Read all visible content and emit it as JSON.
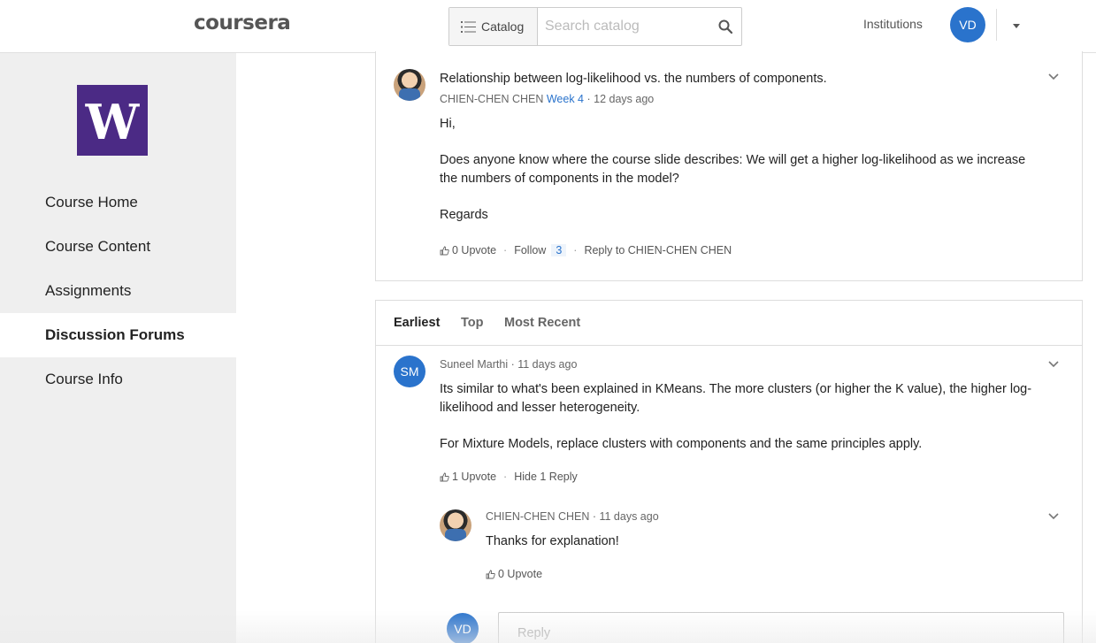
{
  "header": {
    "logo_text": "coursera",
    "catalog_label": "Catalog",
    "search_placeholder": "Search catalog",
    "institutions_label": "Institutions",
    "user_initials": "VD"
  },
  "sidebar": {
    "logo_letter": "W",
    "items": [
      {
        "label": "Course Home"
      },
      {
        "label": "Course Content"
      },
      {
        "label": "Assignments"
      },
      {
        "label": "Discussion Forums",
        "active": true
      },
      {
        "label": "Course Info"
      }
    ]
  },
  "post": {
    "title": "Relationship between log-likelihood vs. the numbers of components.",
    "author": "CHIEN-CHEN CHEN",
    "week": "Week 4",
    "time": "· 12 days ago",
    "body": [
      "Hi,",
      "Does anyone know where the course slide describes: We will get a higher log-likelihood as we increase the numbers of components in the model?",
      "Regards"
    ],
    "upvote_label": "0 Upvote",
    "follow_label": "Follow",
    "follow_count": "3",
    "reply_label": "Reply to CHIEN-CHEN CHEN"
  },
  "sort_tabs": [
    {
      "label": "Earliest",
      "active": true
    },
    {
      "label": "Top"
    },
    {
      "label": "Most Recent"
    }
  ],
  "replies": [
    {
      "initials": "SM",
      "meta": "Suneel Marthi · 11 days ago",
      "body": [
        "Its similar to what's been explained in KMeans. The more clusters (or higher the K value), the higher log-likelihood and lesser heterogeneity.",
        "For Mixture Models, replace clusters with components and the same principles apply."
      ],
      "upvote_label": "1 Upvote",
      "hide_label": "Hide 1 Reply"
    }
  ],
  "nested_reply": {
    "meta": "CHIEN-CHEN CHEN · 11 days ago",
    "body": "Thanks for explanation!",
    "upvote_label": "0 Upvote"
  },
  "reply_input": {
    "user_initials": "VD",
    "placeholder": "Reply"
  },
  "colors": {
    "accent": "#2a73cc",
    "uw_purple": "#4b2a85",
    "sidebar_bg": "#efefef"
  }
}
